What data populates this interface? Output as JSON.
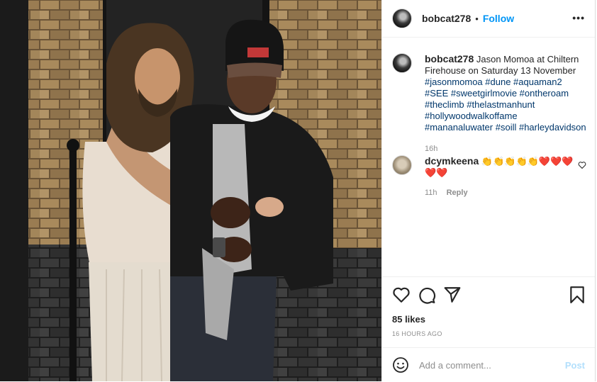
{
  "post": {
    "author": "bobcat278",
    "follow_label": "Follow",
    "separator": "•",
    "more_label": "•••",
    "caption": {
      "username": "bobcat278",
      "text": "Jason Momoa at Chiltern Firehouse on Saturday 13 November",
      "hashtags": "#jasonmomoa #dune #aquaman2 #SEE #sweetgirlmovie #ontheroam #theclimb #thelastmanhunt #hollywoodwalkoffame #mananaluwater #soill #harleydavidson",
      "time": "16h"
    },
    "comments": [
      {
        "username": "dcymkeena",
        "text": "👏👏👏👏👏❤️❤️❤️❤️❤️",
        "time": "11h",
        "reply_label": "Reply"
      }
    ],
    "likes": "85 likes",
    "time_ago": "16 HOURS AGO",
    "add_comment_placeholder": "Add a comment...",
    "post_label": "Post",
    "icons": [
      "heart-icon",
      "comment-icon",
      "share-icon",
      "bookmark-icon",
      "emoji-icon",
      "more-icon"
    ]
  },
  "colors": {
    "link": "#0095f6",
    "hashtag": "#00376b",
    "muted": "#8e8e8e",
    "post_disabled": "#b2dffc"
  }
}
